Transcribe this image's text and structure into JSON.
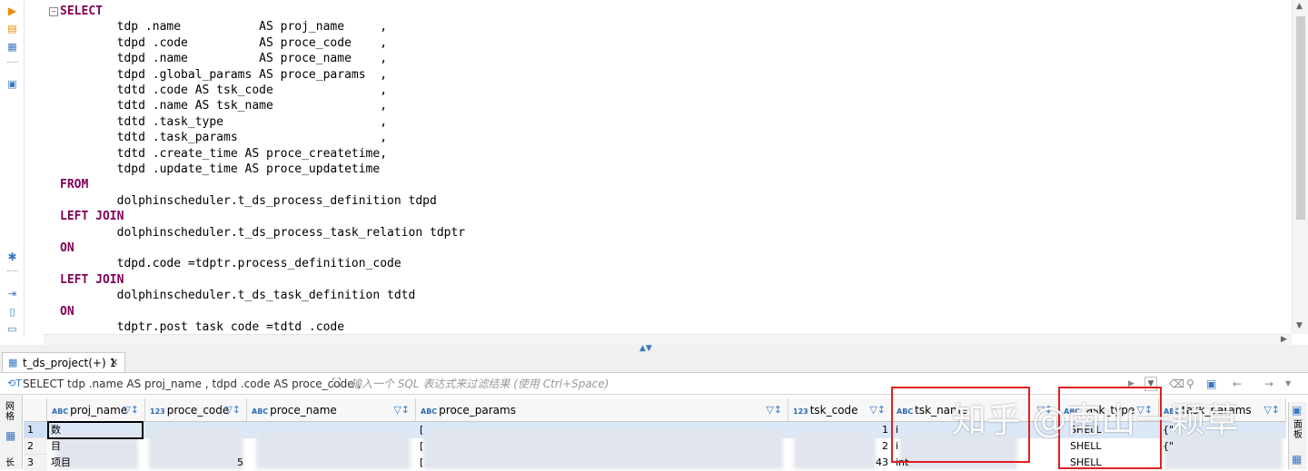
{
  "editor": {
    "lines": [
      {
        "kw": "SELECT",
        "rest": ""
      },
      {
        "kw": "",
        "rest": "        tdp .name           AS proj_name     ,"
      },
      {
        "kw": "",
        "rest": "        tdpd .code          AS proce_code    ,"
      },
      {
        "kw": "",
        "rest": "        tdpd .name          AS proce_name    ,"
      },
      {
        "kw": "",
        "rest": "        tdpd .global_params AS proce_params  ,"
      },
      {
        "kw": "",
        "rest": "        tdtd .code AS tsk_code               ,"
      },
      {
        "kw": "",
        "rest": "        tdtd .name AS tsk_name               ,"
      },
      {
        "kw": "",
        "rest": "        tdtd .task_type                      ,"
      },
      {
        "kw": "",
        "rest": "        tdtd .task_params                    ,"
      },
      {
        "kw": "",
        "rest": "        tdtd .create_time AS proce_createtime,"
      },
      {
        "kw": "",
        "rest": "        tdpd .update_time AS proce_updatetime"
      },
      {
        "kw": "FROM",
        "rest": ""
      },
      {
        "kw": "",
        "rest": "        dolphinscheduler.t_ds_process_definition tdpd"
      },
      {
        "kw": "LEFT JOIN",
        "rest": ""
      },
      {
        "kw": "",
        "rest": "        dolphinscheduler.t_ds_process_task_relation tdptr"
      },
      {
        "kw": "ON",
        "rest": ""
      },
      {
        "kw": "",
        "rest": "        tdpd.code =tdptr.process_definition_code"
      },
      {
        "kw": "LEFT JOIN",
        "rest": ""
      },
      {
        "kw": "",
        "rest": "        dolphinscheduler.t_ds_task_definition tdtd"
      },
      {
        "kw": "ON",
        "rest": ""
      },
      {
        "kw": "",
        "rest": "        tdptr.post task code =tdtd .code"
      }
    ]
  },
  "results": {
    "tab_label": "t_ds_project(+) 1",
    "close_glyph": "✕",
    "query_preview": "SELECT tdp .name AS proj_name , tdpd .code AS proce_code ,",
    "filter_placeholder": "输入一个 SQL 表达式来过滤结果 (使用 Ctrl+Space)",
    "side_tab_grid": "网格",
    "side_tab_text": "长",
    "side_tab_right": "面板",
    "columns": [
      {
        "label": "proj_name",
        "type": "ABC"
      },
      {
        "label": "proce_code",
        "type": "123"
      },
      {
        "label": "proce_name",
        "type": "ABC"
      },
      {
        "label": "proce_params",
        "type": "ABC"
      },
      {
        "label": "tsk_code",
        "type": "123"
      },
      {
        "label": "tsk_name",
        "type": "ABC"
      },
      {
        "label": "task_type",
        "type": "ABC"
      },
      {
        "label": "task_params",
        "type": "ABC"
      }
    ],
    "row_numbers": [
      "1",
      "2",
      "3"
    ],
    "rows": [
      {
        "proj_name": "数",
        "proce_code": "",
        "proce_params": "[",
        "tsk_code": "1",
        "tsk_name": "i",
        "task_type": "SHELL",
        "task_params": "{\""
      },
      {
        "proj_name": "目",
        "proce_code": "",
        "proce_params": "[",
        "tsk_code": "2",
        "tsk_name": "i",
        "task_type": "SHELL",
        "task_params": "{\""
      },
      {
        "proj_name": "项目",
        "proce_code": "5",
        "proce_params": "[",
        "tsk_code": "43",
        "tsk_name": "int",
        "task_type": "SHELL",
        "task_params": ""
      }
    ]
  },
  "watermark": {
    "text": "知乎 @南山一颗草"
  },
  "colors": {
    "keyword": "#7f0055",
    "highlight_border": "#e02020",
    "header_bg": "#f7f7f7",
    "type_badge": "#2a6ab5",
    "selection": "#cfe0f6"
  }
}
